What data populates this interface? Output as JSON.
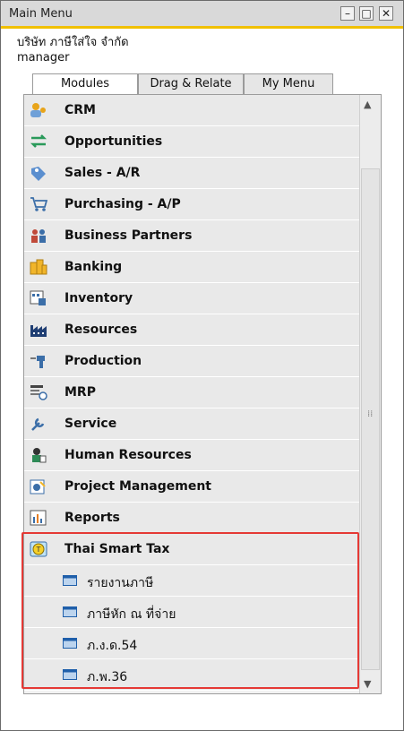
{
  "window": {
    "title": "Main Menu"
  },
  "header": {
    "company": "บริษัท ภาษีใส่ใจ จำกัด",
    "user": "manager"
  },
  "tabs": [
    {
      "label": "Modules"
    },
    {
      "label": "Drag & Relate"
    },
    {
      "label": "My Menu"
    }
  ],
  "modules": [
    {
      "label": "CRM",
      "icon": "crm-icon"
    },
    {
      "label": "Opportunities",
      "icon": "opportunities-icon"
    },
    {
      "label": "Sales - A/R",
      "icon": "sales-icon"
    },
    {
      "label": "Purchasing - A/P",
      "icon": "cart-icon"
    },
    {
      "label": "Business Partners",
      "icon": "partners-icon"
    },
    {
      "label": "Banking",
      "icon": "coins-icon"
    },
    {
      "label": "Inventory",
      "icon": "inventory-icon"
    },
    {
      "label": "Resources",
      "icon": "factory-icon"
    },
    {
      "label": "Production",
      "icon": "production-icon"
    },
    {
      "label": "MRP",
      "icon": "mrp-icon"
    },
    {
      "label": "Service",
      "icon": "wrench-icon"
    },
    {
      "label": "Human Resources",
      "icon": "person-icon"
    },
    {
      "label": "Project Management",
      "icon": "project-icon"
    },
    {
      "label": "Reports",
      "icon": "report-icon"
    },
    {
      "label": "Thai Smart Tax",
      "icon": "tax-icon"
    }
  ],
  "submenu": [
    {
      "label": "รายงานภาษี"
    },
    {
      "label": "ภาษีหัก ณ ที่จ่าย"
    },
    {
      "label": "ภ.ง.ด.54"
    },
    {
      "label": "ภ.พ.36"
    }
  ]
}
